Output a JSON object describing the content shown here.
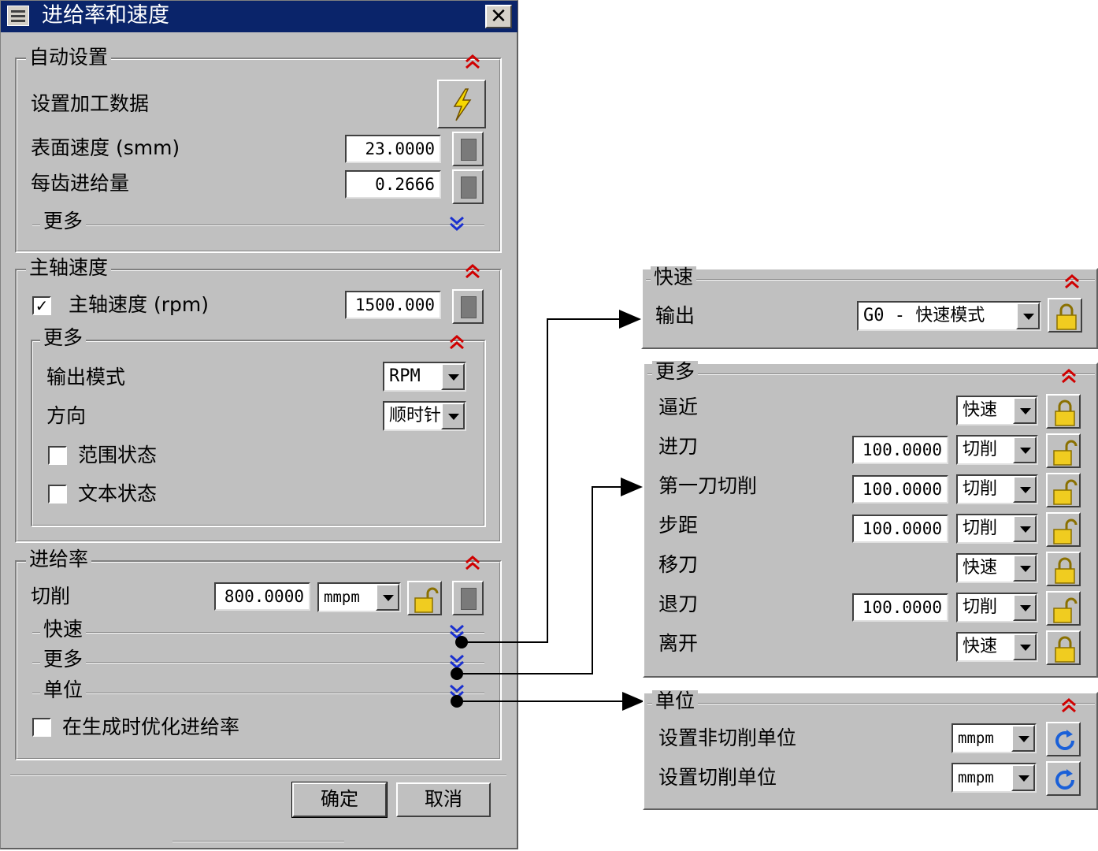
{
  "dialog": {
    "title": "进给率和速度",
    "auto_settings": {
      "label": "自动设置",
      "set_machining_data": "设置加工数据",
      "surface_speed_label": "表面速度 (smm)",
      "surface_speed_value": "23.0000",
      "feed_per_tooth_label": "每齿进给量",
      "feed_per_tooth_value": "0.2666",
      "more_label": "更多"
    },
    "spindle": {
      "label": "主轴速度",
      "spindle_speed_label": "主轴速度 (rpm)",
      "spindle_speed_checked": true,
      "spindle_speed_value": "1500.000",
      "more_label": "更多",
      "output_mode_label": "输出模式",
      "output_mode_value": "RPM",
      "direction_label": "方向",
      "direction_value": "顺时针",
      "range_status_label": "范围状态",
      "range_status_checked": false,
      "text_status_label": "文本状态",
      "text_status_checked": false
    },
    "feedrate": {
      "label": "进给率",
      "cut_label": "切削",
      "cut_value": "800.0000",
      "cut_unit": "mmpm",
      "rapid_label": "快速",
      "more_label": "更多",
      "units_label": "单位",
      "optimize_label": "在生成时优化进给率",
      "optimize_checked": false
    },
    "ok_label": "确定",
    "cancel_label": "取消"
  },
  "rapid_panel": {
    "label": "快速",
    "output_label": "输出",
    "output_value": "G0 - 快速模式"
  },
  "more_panel": {
    "label": "更多",
    "rows": [
      {
        "label": "逼近",
        "value": "",
        "mode": "快速",
        "locked": true
      },
      {
        "label": "进刀",
        "value": "100.0000",
        "mode": "切削",
        "locked": false
      },
      {
        "label": "第一刀切削",
        "value": "100.0000",
        "mode": "切削",
        "locked": false
      },
      {
        "label": "步距",
        "value": "100.0000",
        "mode": "切削",
        "locked": false
      },
      {
        "label": "移刀",
        "value": "",
        "mode": "快速",
        "locked": true
      },
      {
        "label": "退刀",
        "value": "100.0000",
        "mode": "切削",
        "locked": false
      },
      {
        "label": "离开",
        "value": "",
        "mode": "快速",
        "locked": true
      }
    ]
  },
  "units_panel": {
    "label": "单位",
    "non_cut_label": "设置非切削单位",
    "non_cut_value": "mmpm",
    "cut_label": "设置切削单位",
    "cut_value": "mmpm"
  }
}
